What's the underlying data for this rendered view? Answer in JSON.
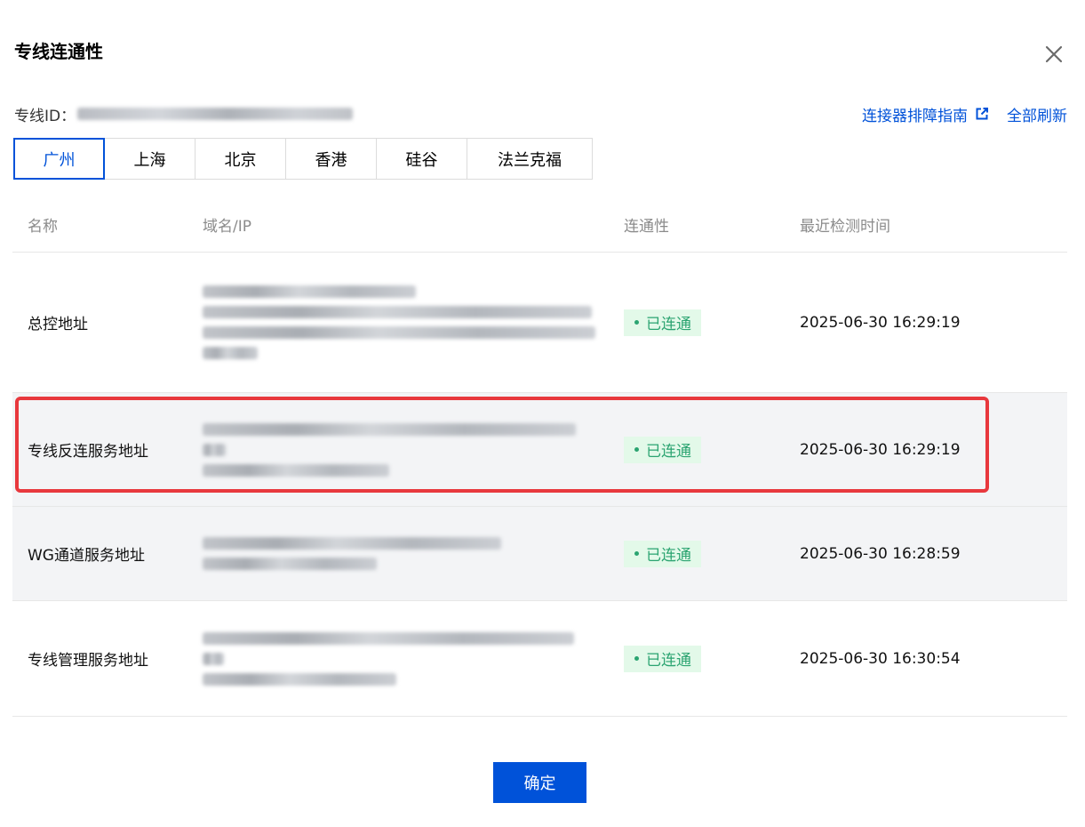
{
  "dialog": {
    "title": "专线连通性",
    "close_icon": "close-icon",
    "id_label": "专线ID：",
    "links": {
      "guide": "连接器排障指南",
      "guide_icon": "external-link-icon",
      "refresh": "全部刷新"
    },
    "tabs": [
      {
        "label": "广州",
        "active": true
      },
      {
        "label": "上海",
        "active": false
      },
      {
        "label": "北京",
        "active": false
      },
      {
        "label": "香港",
        "active": false
      },
      {
        "label": "硅谷",
        "active": false
      },
      {
        "label": "法兰克福",
        "active": false
      }
    ],
    "columns": [
      "名称",
      "域名/IP",
      "连通性",
      "最近检测时间"
    ],
    "rows": [
      {
        "name": "总控地址",
        "status": "已连通",
        "time": "2025-06-30 16:29:19"
      },
      {
        "name": "专线反连服务地址",
        "status": "已连通",
        "time": "2025-06-30 16:29:19"
      },
      {
        "name": "WG通道服务地址",
        "status": "已连通",
        "time": "2025-06-30 16:28:59"
      },
      {
        "name": "专线管理服务地址",
        "status": "已连通",
        "time": "2025-06-30 16:30:54"
      }
    ],
    "confirm_label": "确定"
  },
  "colors": {
    "primary": "#0052d9",
    "success": "#2ba471",
    "success_bg": "#e3f9e9",
    "highlight_border": "#e8383d",
    "row_highlight_bg": "#f3f4f6"
  }
}
